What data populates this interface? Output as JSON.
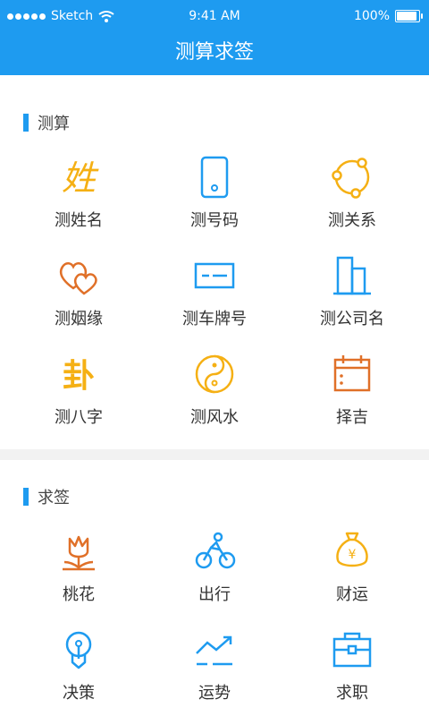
{
  "status_bar": {
    "carrier": "Sketch",
    "time": "9:41 AM",
    "battery": "100%"
  },
  "header": {
    "title": "测算求签"
  },
  "sections": [
    {
      "title": "测算",
      "items": [
        {
          "label": "测姓名",
          "icon": "xing-character-icon"
        },
        {
          "label": "测号码",
          "icon": "phone-icon"
        },
        {
          "label": "测关系",
          "icon": "relationship-network-icon"
        },
        {
          "label": "测姻缘",
          "icon": "double-heart-icon"
        },
        {
          "label": "测车牌号",
          "icon": "license-plate-icon"
        },
        {
          "label": "测公司名",
          "icon": "building-icon"
        },
        {
          "label": "测八字",
          "icon": "gua-character-icon"
        },
        {
          "label": "测风水",
          "icon": "yin-yang-icon"
        },
        {
          "label": "择吉",
          "icon": "calendar-icon"
        }
      ]
    },
    {
      "title": "求签",
      "items": [
        {
          "label": "桃花",
          "icon": "flower-icon"
        },
        {
          "label": "出行",
          "icon": "cyclist-icon"
        },
        {
          "label": "财运",
          "icon": "money-bag-icon"
        },
        {
          "label": "决策",
          "icon": "lightbulb-icon"
        },
        {
          "label": "运势",
          "icon": "trend-icon"
        },
        {
          "label": "求职",
          "icon": "briefcase-icon"
        }
      ]
    }
  ],
  "icon_glyphs": {
    "xing": "姓",
    "gua": "卦",
    "money": "¥"
  },
  "colors": {
    "primary": "#1e9bf0",
    "orange": "#e07028",
    "yellow": "#f5b014"
  }
}
